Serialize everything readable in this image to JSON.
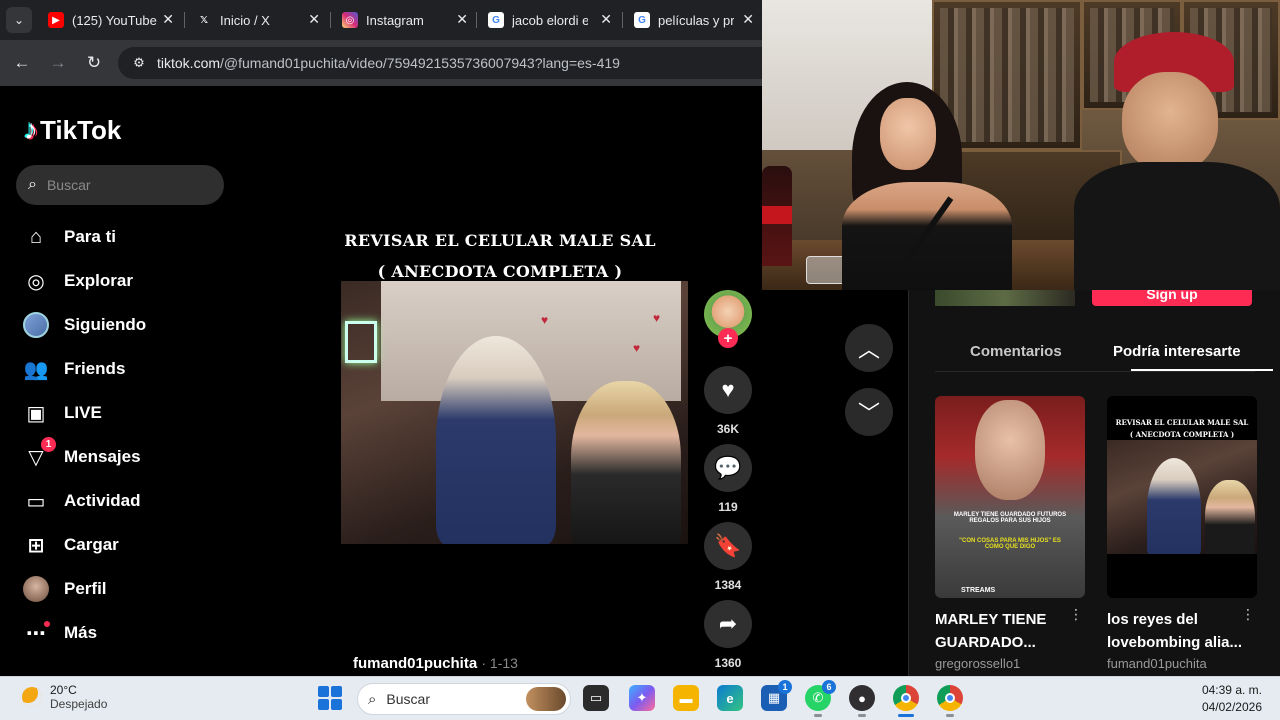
{
  "browser": {
    "tabs": [
      {
        "title": "(125) YouTube",
        "favicon": "youtube-icon",
        "color": "#ff0000"
      },
      {
        "title": "Inicio / X",
        "favicon": "x-icon",
        "color": "#000000"
      },
      {
        "title": "Instagram",
        "favicon": "instagram-icon",
        "color": "#d62976"
      },
      {
        "title": "jacob elordi e",
        "favicon": "google-icon",
        "color": "#4285f4"
      },
      {
        "title": "películas y pro",
        "favicon": "google-icon",
        "color": "#4285f4"
      }
    ],
    "url_host": "tiktok.com",
    "url_path": "/@fumand01puchita/video/7594921535736007943?lang=es-419"
  },
  "tiktok": {
    "brand": "TikTok",
    "search_placeholder": "Buscar",
    "nav": [
      {
        "label": "Para ti",
        "icon": "home-icon"
      },
      {
        "label": "Explorar",
        "icon": "compass-icon"
      },
      {
        "label": "Siguiendo",
        "icon": "following-avatar-icon"
      },
      {
        "label": "Friends",
        "icon": "friends-icon"
      },
      {
        "label": "LIVE",
        "icon": "live-tv-icon"
      },
      {
        "label": "Mensajes",
        "icon": "send-icon",
        "badge": "1"
      },
      {
        "label": "Actividad",
        "icon": "activity-icon"
      },
      {
        "label": "Cargar",
        "icon": "upload-plus-icon"
      },
      {
        "label": "Perfil",
        "icon": "profile-avatar-icon"
      },
      {
        "label": "Más",
        "icon": "more-dots-icon"
      }
    ],
    "video": {
      "caption_line1": "REVISAR EL CELULAR MALE SAL",
      "caption_line2": "( ANECDOTA COMPLETA )",
      "author": "fumand01puchita",
      "date": "· 1-13",
      "likes": "36K",
      "comments": "119",
      "saves": "1384",
      "shares": "1360"
    },
    "right_panel": {
      "signup_label": "Sign up",
      "tab_comments": "Comentarios",
      "tab_suggested": "Podría interesarte",
      "cards": [
        {
          "title": "MARLEY TIENE GUARDADO...",
          "user": "gregorossello1",
          "thumb_text": "MARLEY TIENE GUARDADO FUTUROS REGALOS PARA SUS HIJOS",
          "thumb_quote": "\"CON COSAS PARA MIS HIJOS\" ES COMO QUE DIGO",
          "thumb_brand": "STREAMS"
        },
        {
          "title": "los reyes del lovebombing alia...",
          "user": "fumand01puchita",
          "thumb_line1": "REVISAR EL CELULAR MALE SAL",
          "thumb_line2": "( ANECDOTA COMPLETA )"
        }
      ]
    }
  },
  "taskbar": {
    "temp": "20°C",
    "condition": "Despejado",
    "search_label": "Buscar",
    "time": "04:39 a. m.",
    "date": "04/02/2026",
    "apps": [
      {
        "name": "task-view-icon",
        "color": "#2b2b2b"
      },
      {
        "name": "copilot-icon",
        "color": "#7b5cf0"
      },
      {
        "name": "file-explorer-icon",
        "color": "#f4b400"
      },
      {
        "name": "edge-icon",
        "color": "#0c7bd1"
      },
      {
        "name": "store-icon",
        "color": "#1a5fb4",
        "badge": "1"
      },
      {
        "name": "whatsapp-icon",
        "color": "#25d366",
        "badge": "6"
      },
      {
        "name": "obs-icon",
        "color": "#302e31"
      },
      {
        "name": "chrome-icon",
        "color": "#db4437"
      },
      {
        "name": "chrome-profile-icon",
        "color": "#0f9d58"
      }
    ]
  }
}
